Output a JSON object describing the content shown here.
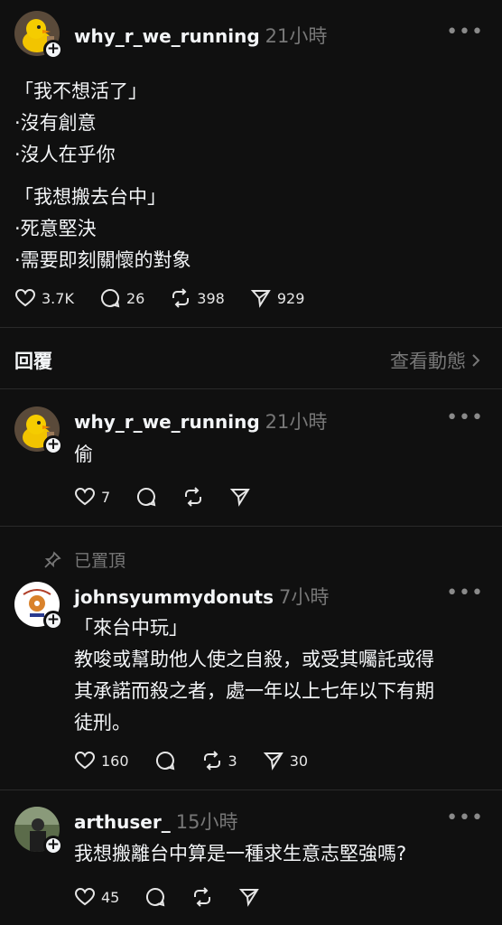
{
  "post": {
    "username": "why_r_we_running",
    "time": "21小時",
    "lines": [
      "「我不想活了」",
      "·沒有創意",
      "·沒人在乎你",
      "",
      "「我想搬去台中」",
      "·死意堅決",
      "·需要即刻關懷的對象"
    ],
    "likes": "3.7K",
    "comments": "26",
    "reposts": "398",
    "shares": "929"
  },
  "replies_header": {
    "title": "回覆",
    "activity_link": "查看動態"
  },
  "replies": [
    {
      "username": "why_r_we_running",
      "time": "21小時",
      "text": "偷",
      "likes": "7"
    },
    {
      "pinned_label": "已置頂",
      "username": "johnsyummydonuts",
      "time": "7小時",
      "lines": [
        "「來台中玩」",
        "教唆或幫助他人使之自殺，或受其囑託或得",
        "其承諾而殺之者，處一年以上七年以下有期",
        "徒刑。"
      ],
      "likes": "160",
      "reposts": "3",
      "shares": "30"
    },
    {
      "username": "arthuser_",
      "time": "15小時",
      "text": "我想搬離台中算是一種求生意志堅強嗎?",
      "likes": "45"
    }
  ],
  "icons": {
    "like": "heart-icon",
    "comment": "comment-bubble-icon",
    "repost": "repost-icon",
    "share": "send-icon",
    "more": "more-dots-icon",
    "follow": "plus-icon",
    "pin": "pin-icon",
    "chevron": "chevron-right-icon"
  },
  "colors": {
    "background": "#101010",
    "text": "#f3f5f7",
    "muted": "#777777",
    "divider": "#2a2a2a"
  }
}
